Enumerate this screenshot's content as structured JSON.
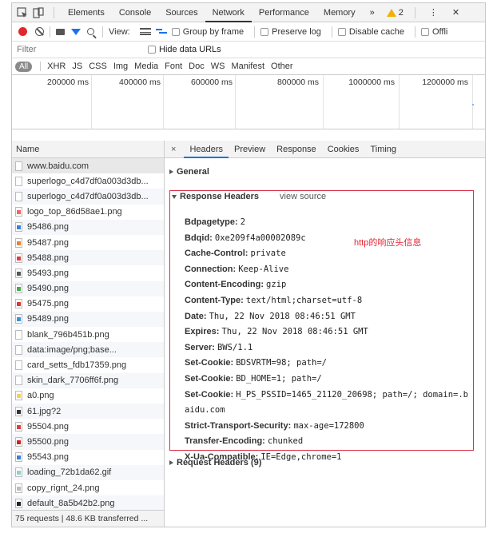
{
  "devtools": {
    "tabs": [
      "Elements",
      "Console",
      "Sources",
      "Network",
      "Performance",
      "Memory"
    ],
    "active_tab": "Network",
    "more_glyph": "»",
    "warning_count": "2",
    "kebab_glyph": "⋮",
    "close_glyph": "✕"
  },
  "toolbar": {
    "view_label": "View:",
    "group_by_frame": "Group by frame",
    "preserve_log": "Preserve log",
    "disable_cache": "Disable cache",
    "offline": "Offli"
  },
  "filter": {
    "placeholder": "Filter",
    "hide_data_urls": "Hide data URLs"
  },
  "type_filters": [
    "All",
    "XHR",
    "JS",
    "CSS",
    "Img",
    "Media",
    "Font",
    "Doc",
    "WS",
    "Manifest",
    "Other"
  ],
  "timeline": {
    "ticks": [
      "200000 ms",
      "400000 ms",
      "600000 ms",
      "800000 ms",
      "1000000 ms",
      "1200000 ms"
    ]
  },
  "requests": {
    "header": "Name",
    "items": [
      {
        "name": "www.baidu.com",
        "color": "#ffffff"
      },
      {
        "name": "superlogo_c4d7df0a003d3db...",
        "color": "#ffffff"
      },
      {
        "name": "superlogo_c4d7df0a003d3db...",
        "color": "#ffffff"
      },
      {
        "name": "logo_top_86d58ae1.png",
        "color": "#e66"
      },
      {
        "name": "95486.png",
        "color": "#3a7fd8"
      },
      {
        "name": "95487.png",
        "color": "#e8823a"
      },
      {
        "name": "95488.png",
        "color": "#d94040"
      },
      {
        "name": "95493.png",
        "color": "#555555"
      },
      {
        "name": "95490.png",
        "color": "#4aa84a"
      },
      {
        "name": "95475.png",
        "color": "#d13a3a"
      },
      {
        "name": "95489.png",
        "color": "#3a8fd8"
      },
      {
        "name": "blank_796b451b.png",
        "color": "#ffffff"
      },
      {
        "name": "data:image/png;base...",
        "color": "#ffffff"
      },
      {
        "name": "card_setts_fdb17359.png",
        "color": "#ffffff"
      },
      {
        "name": "skin_dark_7706ff6f.png",
        "color": "#ffffff"
      },
      {
        "name": "a0.png",
        "color": "#f0d060"
      },
      {
        "name": "61.jpg?2",
        "color": "#333333"
      },
      {
        "name": "95504.png",
        "color": "#d94040"
      },
      {
        "name": "95500.png",
        "color": "#c22"
      },
      {
        "name": "95543.png",
        "color": "#3a7fd8"
      },
      {
        "name": "loading_72b1da62.gif",
        "color": "#9cc"
      },
      {
        "name": "copy_rignt_24.png",
        "color": "#bbbbbb"
      },
      {
        "name": "default_8a5b42b2.png",
        "color": "#222222"
      }
    ],
    "selected_index": 0,
    "status": "75 requests | 48.6 KB transferred ..."
  },
  "detail": {
    "tabs": [
      "Headers",
      "Preview",
      "Response",
      "Cookies",
      "Timing"
    ],
    "active_tab": "Headers",
    "close_glyph": "×",
    "general": "General",
    "response_headers": "Response Headers",
    "view_source": "view source",
    "request_headers": "Request Headers (9)",
    "annotation": "http的响应头信息",
    "headers": [
      {
        "k": "Bdpagetype:",
        "v": "2"
      },
      {
        "k": "Bdqid:",
        "v": "0xe209f4a00002089c"
      },
      {
        "k": "Cache-Control:",
        "v": "private"
      },
      {
        "k": "Connection:",
        "v": "Keep-Alive"
      },
      {
        "k": "Content-Encoding:",
        "v": "gzip"
      },
      {
        "k": "Content-Type:",
        "v": "text/html;charset=utf-8"
      },
      {
        "k": "Date:",
        "v": "Thu, 22 Nov 2018 08:46:51 GMT"
      },
      {
        "k": "Expires:",
        "v": "Thu, 22 Nov 2018 08:46:51 GMT"
      },
      {
        "k": "Server:",
        "v": "BWS/1.1"
      },
      {
        "k": "Set-Cookie:",
        "v": "BDSVRTM=98; path=/"
      },
      {
        "k": "Set-Cookie:",
        "v": "BD_HOME=1; path=/"
      },
      {
        "k": "Set-Cookie:",
        "v": "H_PS_PSSID=1465_21120_20698; path=/; domain=.b"
      },
      {
        "k": "",
        "v": "aidu.com"
      },
      {
        "k": "Strict-Transport-Security:",
        "v": "max-age=172800"
      },
      {
        "k": "Transfer-Encoding:",
        "v": "chunked"
      },
      {
        "k": "X-Ua-Compatible:",
        "v": "IE=Edge,chrome=1"
      }
    ]
  },
  "colors": {
    "accent": "#1a73e8",
    "record": "#e0282c",
    "highlight_border": "#d9334a",
    "annotation": "#e52535"
  }
}
